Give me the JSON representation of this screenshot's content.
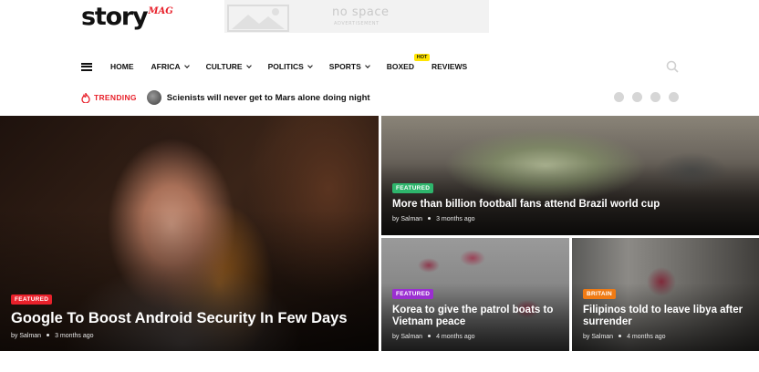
{
  "brand": {
    "name": "story",
    "sub": "MAG"
  },
  "ad": {
    "title": "no space",
    "subtitle": "ADVERTISEMENT"
  },
  "nav": {
    "items": [
      {
        "label": "HOME"
      },
      {
        "label": "AFRICA"
      },
      {
        "label": "CULTURE"
      },
      {
        "label": "POLITICS"
      },
      {
        "label": "SPORTS"
      },
      {
        "label": "BOXED"
      },
      {
        "label": "REVIEWS"
      }
    ],
    "hot_badge": "HOT"
  },
  "trending": {
    "label": "TRENDING",
    "headline": "Scienists will never get to Mars alone doing night"
  },
  "socials": [
    "twitter-icon",
    "facebook-icon",
    "instagram-icon",
    "pinterest-icon"
  ],
  "colors": {
    "accent": "#e8212b",
    "hot": "#ffe400",
    "featured_red": "#e8212b",
    "featured_green": "#2eb56c",
    "featured_purple": "#9b2fd1",
    "britain_orange": "#f07b14"
  },
  "cards": {
    "main": {
      "badge": "FEATURED",
      "title": "Google To Boost Android Security In Few Days",
      "author": "by Salman",
      "time": "3 months ago"
    },
    "top_right": {
      "badge": "FEATURED",
      "title": "More than billion football fans attend Brazil world cup",
      "author": "by Salman",
      "time": "3 months ago"
    },
    "bottom_left": {
      "badge": "FEATURED",
      "title": "Korea to give the patrol boats to Vietnam peace",
      "author": "by Salman",
      "time": "4 months ago"
    },
    "bottom_right": {
      "badge": "BRITAIN",
      "title": "Filipinos told to leave libya after surrender",
      "author": "by Salman",
      "time": "4 months ago"
    }
  }
}
